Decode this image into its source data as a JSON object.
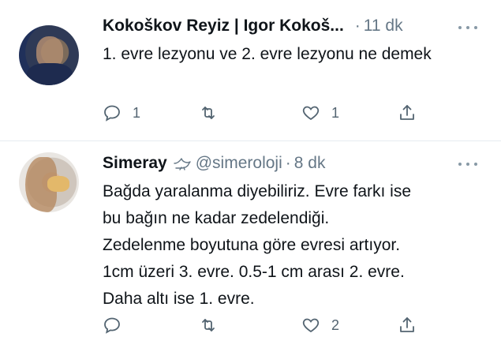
{
  "tweets": [
    {
      "name": "Kokoškov Reyiz | Igor Kokoš...",
      "handle": "",
      "time": "11 dk",
      "text": "1. evre lezyonu ve 2. evre lezyonu ne demek",
      "reply_count": "1",
      "retweet_count": "",
      "like_count": "1"
    },
    {
      "name": "Simeray",
      "handle": "@simeroloji",
      "time": "8 dk",
      "text_lines": [
        "Bağda yaralanma diyebiliriz. Evre farkı ise",
        "bu bağın ne kadar zedelendiği.",
        "Zedelenme boyutuna göre evresi artıyor.",
        "1cm üzeri 3. evre. 0.5-1 cm arası 2. evre.",
        "Daha altı ise 1. evre."
      ],
      "reply_count": "",
      "retweet_count": "",
      "like_count": "2"
    }
  ],
  "dot_separator": "·",
  "icons": {
    "reply": "reply-icon",
    "retweet": "retweet-icon",
    "like": "heart-icon",
    "share": "share-icon",
    "more": "more-icon",
    "bird": "bird-icon"
  },
  "colors": {
    "text": "#0f1419",
    "muted": "#657786",
    "divider": "#e6ecf0"
  }
}
